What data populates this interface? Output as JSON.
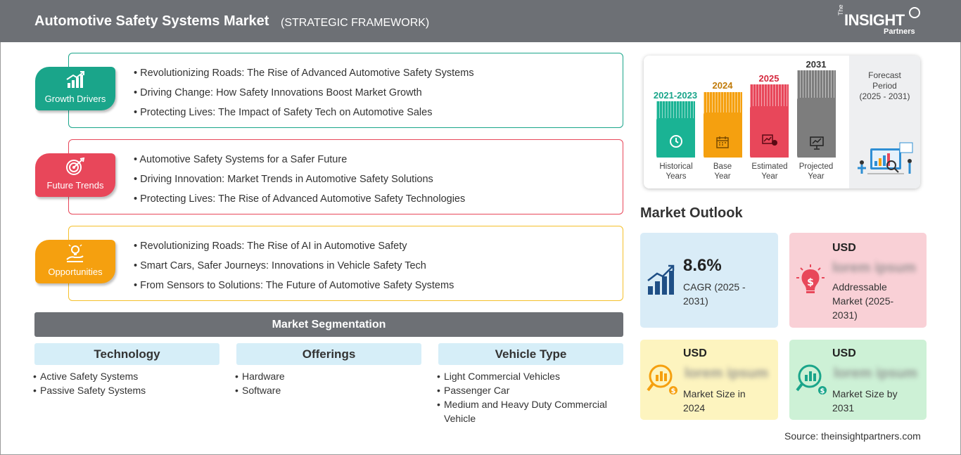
{
  "header": {
    "title": "Automotive Safety Systems Market",
    "subtitle": "(STRATEGIC FRAMEWORK)",
    "logo": {
      "prefix": "The",
      "main": "INSIGHT",
      "sub": "Partners"
    }
  },
  "framework": [
    {
      "label": "Growth Drivers",
      "icon": "bar-growth-icon",
      "color": "#1aa58a",
      "items": [
        "Revolutionizing Roads: The Rise of Advanced Automotive Safety Systems",
        "Driving Change: How Safety Innovations Boost Market Growth",
        "Protecting Lives: The Impact of Safety Tech on Automotive Sales"
      ]
    },
    {
      "label": "Future Trends",
      "icon": "target-icon",
      "color": "#e8475a",
      "items": [
        "Automotive Safety Systems for a Safer Future",
        "Driving Innovation: Market Trends in Automotive Safety Solutions",
        "Protecting Lives: The Rise of Advanced Automotive Safety Technologies"
      ]
    },
    {
      "label": "Opportunities",
      "icon": "lightbulb-hand-icon",
      "color": "#f5a00f",
      "items": [
        "Revolutionizing Roads: The Rise of AI in Automotive Safety",
        "Smart Cars, Safer Journeys: Innovations in Vehicle Safety Tech",
        "From Sensors to Solutions: The Future of Automotive Safety Systems"
      ]
    }
  ],
  "segmentation": {
    "title": "Market Segmentation",
    "columns": [
      {
        "heading": "Technology",
        "items": [
          "Active Safety Systems",
          "Passive Safety Systems"
        ]
      },
      {
        "heading": "Offerings",
        "items": [
          "Hardware",
          "Software"
        ]
      },
      {
        "heading": "Vehicle Type",
        "items": [
          "Light Commercial Vehicles",
          "Passenger Car",
          "Medium and Heavy Duty Commercial Vehicle"
        ]
      }
    ]
  },
  "timeline": {
    "bars": [
      {
        "year": "2021-2023",
        "label1": "Historical",
        "label2": "Years",
        "color": "#1ab394",
        "icon": "history-icon"
      },
      {
        "year": "2024",
        "label1": "Base",
        "label2": "Year",
        "color": "#f5a00f",
        "icon": "calendar-icon"
      },
      {
        "year": "2025",
        "label1": "Estimated",
        "label2": "Year",
        "color": "#e8475a",
        "icon": "estimate-chart-icon"
      },
      {
        "year": "2031",
        "label1": "Projected",
        "label2": "Year",
        "color": "#7d7d7d",
        "icon": "presentation-icon"
      }
    ],
    "forecast": {
      "line1": "Forecast",
      "line2": "Period",
      "line3": "(2025 - 2031)"
    }
  },
  "outlook": {
    "title": "Market Outlook",
    "cagr": {
      "value": "8.6%",
      "label": "CAGR (2025 - 2031)",
      "color": "#d9ecf7"
    },
    "addressable": {
      "usd": "USD",
      "value": "lorem ipsum",
      "label": "Addressable Market (2025-2031)",
      "color": "#f9d0d6"
    },
    "size2024": {
      "usd": "USD",
      "value": "lorem ipsum",
      "label": "Market Size in 2024",
      "color": "#fdf4bf"
    },
    "size2031": {
      "usd": "USD",
      "value": "lorem ipsum",
      "label": "Market Size by 2031",
      "color": "#cdf1d6"
    }
  },
  "source": "Source: theinsightpartners.com"
}
